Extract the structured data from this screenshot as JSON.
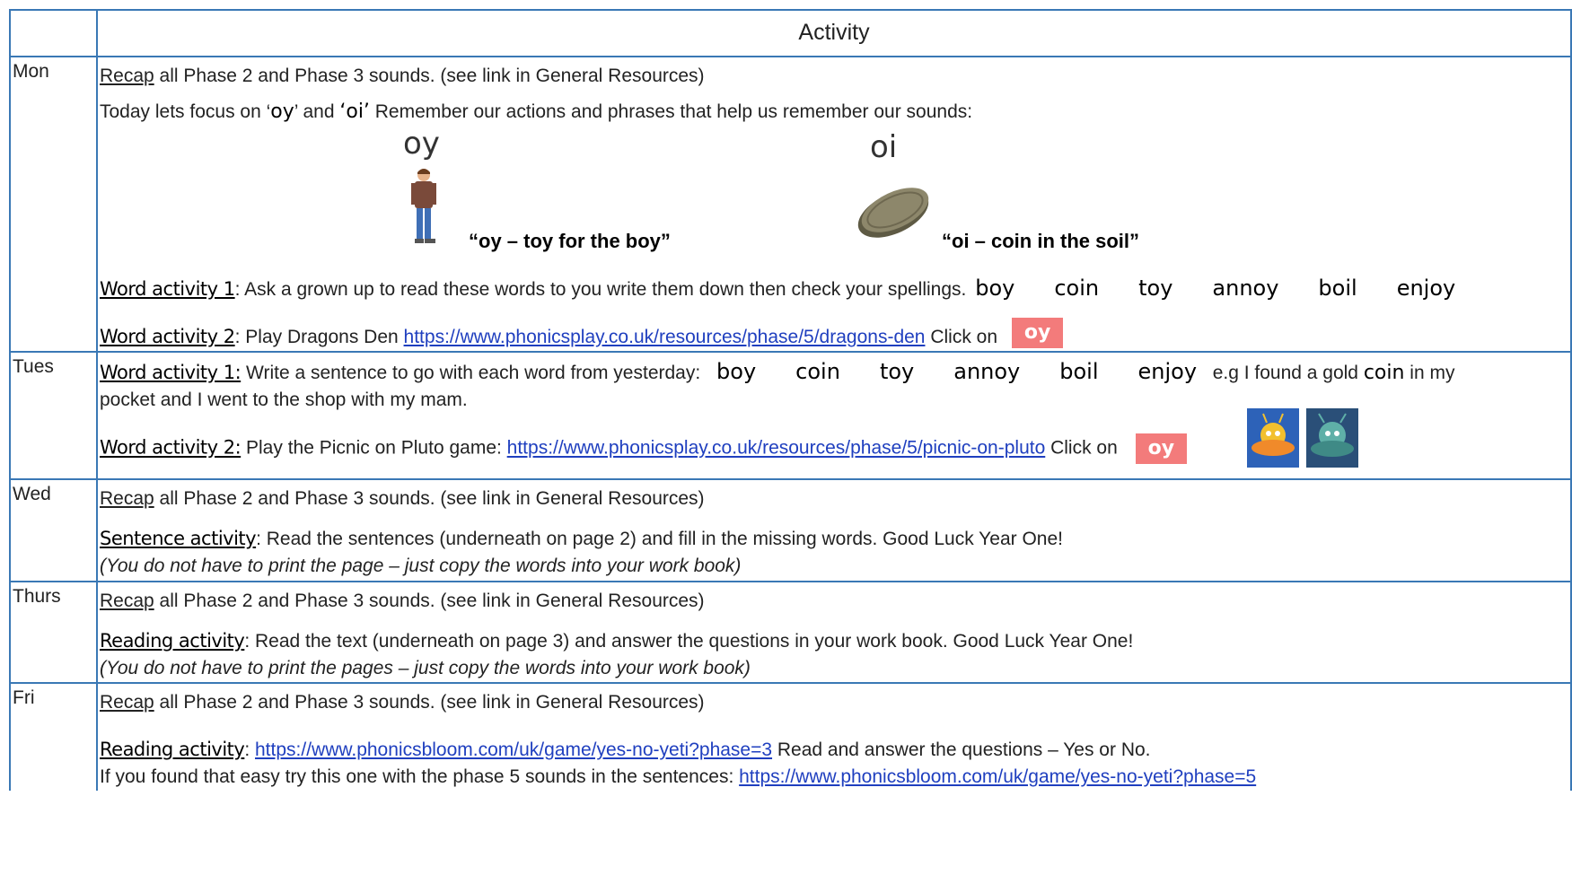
{
  "header": {
    "title": "Activity"
  },
  "days": {
    "mon": "Mon",
    "tues": "Tues",
    "wed": "Wed",
    "thurs": "Thurs",
    "fri": "Fri"
  },
  "recap": {
    "label": "Recap",
    "text": " all Phase 2 and Phase 3 sounds. (see link in General Resources)"
  },
  "mon": {
    "focus_prefix": "Today lets focus on  ‘",
    "focus_oy": "oy",
    "focus_mid": "’ and ",
    "focus_oi": "‘oi’",
    "focus_suffix": "  Remember our actions and phrases that help us remember our sounds:",
    "oy_grapheme": "oy",
    "oy_phrase": "“oy – toy for the boy”",
    "oi_grapheme": "oi",
    "oi_phrase": "“oi – coin in the soil”",
    "wa1_label": "Word activity 1",
    "wa1_text": ": Ask a grown up to read these words to you write them down then check your spellings.",
    "words": [
      "boy",
      "coin",
      "toy",
      "annoy",
      "boil",
      "enjoy"
    ],
    "wa2_label": "Word activity 2",
    "wa2_text": ": Play Dragons Den  ",
    "wa2_link": "https://www.phonicsplay.co.uk/resources/phase/5/dragons-den",
    "click_on": "  Click on",
    "oy_button": "oy"
  },
  "tues": {
    "wa1_label": "Word activity 1:",
    "wa1_text": " Write a sentence to go with each word from yesterday:",
    "words": [
      "boy",
      "coin",
      "toy",
      "annoy",
      "boil",
      "enjoy"
    ],
    "eg_prefix": "e.g I found a gold ",
    "eg_word": "coin",
    "eg_suffix": " in my",
    "eg_line2": "pocket and I went to the shop with my mam.",
    "wa2_label": "Word activity 2:",
    "wa2_text": " Play the Picnic on Pluto game:  ",
    "wa2_link": "https://www.phonicsplay.co.uk/resources/phase/5/picnic-on-pluto",
    "click_on": " Click on",
    "oy_button": "oy"
  },
  "wed": {
    "sa_label": "Sentence activity",
    "sa_text": ": Read the sentences (underneath on page 2) and fill in the missing words. Good Luck Year One!",
    "note": "(You do not have to print the page – just copy the words into your work book)"
  },
  "thurs": {
    "ra_label": "Reading activity",
    "ra_text": ": Read the text (underneath on page 3) and answer the questions in your work book.  Good Luck Year One!",
    "note": "(You do not have to print the pages – just copy the words into your work book)"
  },
  "fri": {
    "ra_label": "Reading activity",
    "ra_sep": ":   ",
    "ra_link": "https://www.phonicsbloom.com/uk/game/yes-no-yeti?phase=3",
    "ra_text": " Read and answer the questions – Yes or No.",
    "easy_text": "If you found that easy try this one with the phase 5 sounds in the sentences:   ",
    "easy_link": "https://www.phonicsbloom.com/uk/game/yes-no-yeti?phase=5"
  },
  "colors": {
    "border": "#3a78b5",
    "link": "#1f3fbf",
    "oy_button": "#f37b7b"
  },
  "icons": [
    "boy-figure-icon",
    "coin-icon",
    "alien-ufo-icon"
  ]
}
